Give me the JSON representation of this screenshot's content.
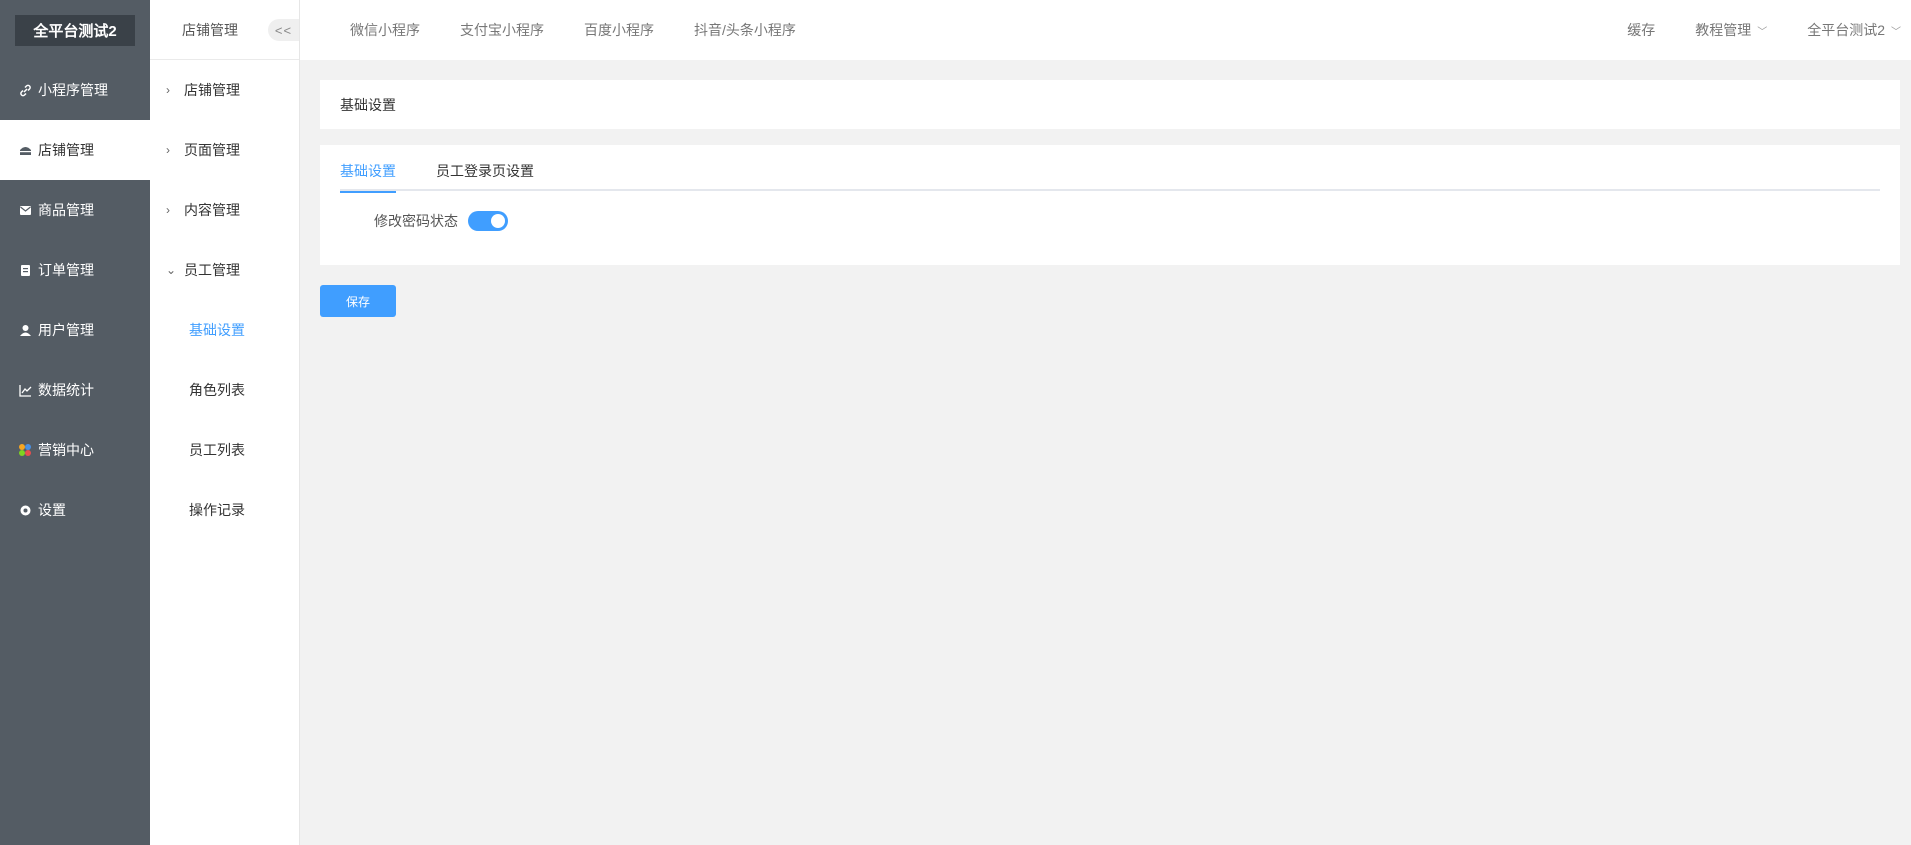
{
  "brand": "全平台测试2",
  "sidebar": {
    "items": [
      {
        "label": "小程序管理",
        "icon": "link-icon"
      },
      {
        "label": "店铺管理",
        "icon": "store-icon"
      },
      {
        "label": "商品管理",
        "icon": "envelope-icon"
      },
      {
        "label": "订单管理",
        "icon": "clipboard-icon"
      },
      {
        "label": "用户管理",
        "icon": "user-icon"
      },
      {
        "label": "数据统计",
        "icon": "chart-icon"
      },
      {
        "label": "营销中心",
        "icon": "marketing-icon"
      },
      {
        "label": "设置",
        "icon": "gear-icon"
      }
    ]
  },
  "subside": {
    "title": "店铺管理",
    "collapse": "<<",
    "groups": [
      "店铺管理",
      "页面管理",
      "内容管理",
      "员工管理"
    ],
    "items": [
      "基础设置",
      "角色列表",
      "员工列表",
      "操作记录"
    ]
  },
  "topbar": {
    "tabs": [
      "微信小程序",
      "支付宝小程序",
      "百度小程序",
      "抖音/头条小程序"
    ],
    "right": [
      "缓存",
      "教程管理",
      "全平台测试2"
    ]
  },
  "content": {
    "header": "基础设置",
    "tabs": [
      "基础设置",
      "员工登录页设置"
    ],
    "form": {
      "label": "修改密码状态",
      "switch_on": true
    },
    "save_label": "保存"
  },
  "colors": {
    "accent": "#409eff",
    "sidebar": "#545c64"
  }
}
